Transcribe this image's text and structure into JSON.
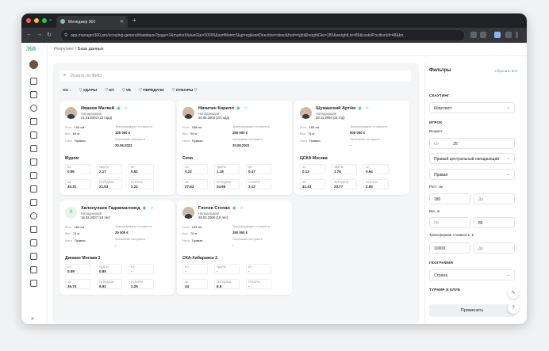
{
  "browser": {
    "tab_title": "Менеджер 360",
    "url": "app.manager360.pro/scouting-general/database?page=1&marketValueGte=10000&sortMetricSlug=xg&sortDirection=desc&foot=right&heightGte=180&weightLte=85&rustolPositionId=48&bir..."
  },
  "app": {
    "logo": "360"
  },
  "breadcrumb": {
    "root": "Рекрутинг",
    "sep": "/",
    "current": "База данных"
  },
  "search": {
    "placeholder": "Искать по ФИО"
  },
  "sort_bar": [
    {
      "label": "XG"
    },
    {
      "label": "УДАРЫ"
    },
    {
      "label": "КП"
    },
    {
      "label": "VE"
    },
    {
      "label": "ПЕРЕДАЧИ"
    },
    {
      "label": "ОТБОРЫ"
    }
  ],
  "labels": {
    "height": "Рост",
    "weight": "Вес",
    "foot": "Нога",
    "transfer": "Трансфермаркт стоимость",
    "contract": "Окончание контракта",
    "xg": "XG",
    "shots": "УДАРЫ",
    "kp": "КП",
    "xa": "XA",
    "passes": "ПЕРЕДАЧИ",
    "tackles": "ОТБОРЫ"
  },
  "players": [
    {
      "name": "Иванов Матвей",
      "position": "Нападающий",
      "dob": "21.01.2003 (22 года)",
      "height": "190 см",
      "weight": "84 кг",
      "foot": "Правая",
      "value": "100 000 €",
      "contract": "30.06.2022",
      "club": "Муром",
      "xg": "0.56",
      "shots": "2.17",
      "kp": "0.62",
      "xa": "40.31",
      "passes": "21.53",
      "tackles": "2.22"
    },
    {
      "name": "Никитин Кирилл",
      "position": "Нападающий",
      "dob": "20.05.2003 (23 года)",
      "height": "188 см",
      "weight": "59 кг",
      "foot": "Правая",
      "value": "250 000 €",
      "contract": "30.06.2021",
      "club": "Сочи",
      "xg": "0.22",
      "shots": "1.18",
      "kp": "0.47",
      "xa": "27.63",
      "passes": "24.65",
      "tackles": "2.12"
    },
    {
      "name": "Шуманский Артём",
      "position": "Нападающий",
      "dob": "28.11.2004 (21 год)",
      "height": "185 см",
      "weight": "75 кг",
      "foot": "Правая",
      "value": "500 000 €",
      "contract": "-",
      "club": "ЦСКА Москва",
      "xg": "0.13",
      "shots": "1.76",
      "kp": "0.64",
      "xa": "41.43",
      "passes": "20.77",
      "tackles": "2.06"
    },
    {
      "name": "Халилулаев Гаджимагомед",
      "position": "Нападающий",
      "dob": "16.02.2007 (18 лет)",
      "height": "180 см",
      "weight": "75 кг",
      "foot": "Правая",
      "value": "25 000 €",
      "contract": "-",
      "club": "Динамо Москва 2",
      "xg": "0.09",
      "shots": "0.85",
      "kp": "-",
      "xa": "26.74",
      "passes": "8.92",
      "tackles": "2.25"
    },
    {
      "name": "Глотов Степан",
      "position": "Нападающий",
      "dob": "28.03.2006 (19 лет)",
      "height": "183 см",
      "weight": "70 кг",
      "foot": "Правая",
      "value": "350 000 €",
      "contract": "-",
      "club": "СКА-Хабаровск 2",
      "xg": "-",
      "shots": "-",
      "kp": "-",
      "xa": "44",
      "passes": "8.5",
      "tackles": "-"
    }
  ],
  "filters": {
    "title": "Фильтры",
    "reset": "Сбросить все",
    "scouting_title": "СКАУТИНГ",
    "scouting_value": "Шортлист",
    "player_title": "ИГРОК",
    "age_label": "Возраст",
    "from": "От",
    "to": "До",
    "age_from": "25",
    "position": "Правый центральный нападающий",
    "foot": "Правая",
    "height_label": "Рост, см",
    "height_from": "180",
    "weight_label": "Вес, кг",
    "weight_to": "85",
    "value_label": "Трансферная стоимость, €",
    "value_from": "10000",
    "geo_title": "ГЕОГРАФИЯ",
    "geo_value": "Страна",
    "tour_title": "ТУРНИР И КЛУБ",
    "apply": "Применить"
  }
}
